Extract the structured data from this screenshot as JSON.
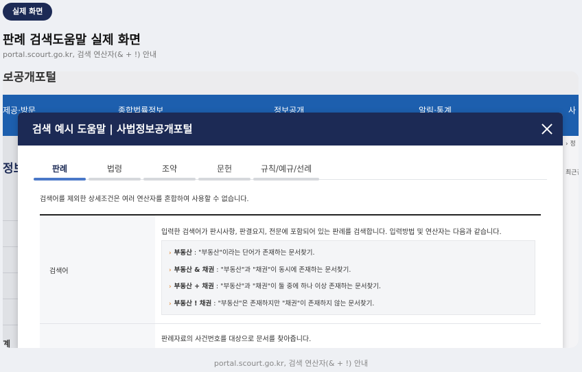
{
  "badge": "실제 화면",
  "title": "판례 검색도움말 실제 화면",
  "subtitle": "portal.scourt.go.kr, 검색 연산자(& + !) 안내",
  "caption": "portal.scourt.go.kr, 검색 연산자(& + !) 안내",
  "background": {
    "logo": "보공개포털",
    "nav": [
      "제공·방문",
      "종합법률정보",
      "정보공개",
      "알림·통계",
      "사"
    ],
    "side": "정보",
    "right_crumb": "› 정",
    "right_tab": "최근검",
    "bottom": "계"
  },
  "modal": {
    "title": "검색 예시 도움말 | 사법정보공개포털",
    "tabs": [
      "판례",
      "법령",
      "조약",
      "문헌",
      "규칙/예규/선례"
    ],
    "intro": "검색어를 제외한 상세조건은 여러 연산자를 혼합하여 사용할 수 없습니다.",
    "row1": {
      "label": "검색어",
      "desc": "입력한 검색어가 판시사항, 판결요지, 전문에 포함되어 있는 판례를 검색합니다.   입력방법 및 연산자는 다음과 같습니다.",
      "examples": [
        {
          "keyword": "부동산",
          "text": " : \"부동산\"이라는 단어가 존재하는 문서찾기."
        },
        {
          "keyword": "부동산 & 채권",
          "text": " : \"부동산\"과 \"채권\"이 동시에 존재하는 문서찾기."
        },
        {
          "keyword": "부동산 + 채권",
          "text": " : \"부동산\"과 \"채권\"이 둘 중에 하나 이상 존재하는 문서찾기."
        },
        {
          "keyword": "부동산 ! 채권",
          "text": " : \"부동산\"은 존재하지만 \"채권\"이 존재하지 않는 문서찾기."
        }
      ]
    },
    "row2": {
      "desc": "판례자료의 사건번호를 대상으로 문서를 찾아줍니다."
    }
  }
}
